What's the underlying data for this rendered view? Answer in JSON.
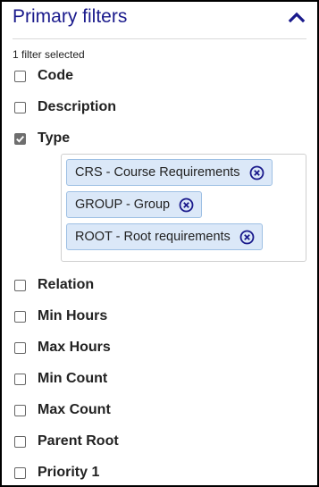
{
  "panel": {
    "title": "Primary filters",
    "selected_count": "1 filter selected"
  },
  "filters": [
    {
      "label": "Code",
      "checked": false
    },
    {
      "label": "Description",
      "checked": false
    },
    {
      "label": "Type",
      "checked": true
    },
    {
      "label": "Relation",
      "checked": false
    },
    {
      "label": "Min Hours",
      "checked": false
    },
    {
      "label": "Max Hours",
      "checked": false
    },
    {
      "label": "Min Count",
      "checked": false
    },
    {
      "label": "Max Count",
      "checked": false
    },
    {
      "label": "Parent Root",
      "checked": false
    },
    {
      "label": "Priority 1",
      "checked": false
    }
  ],
  "type_selections": [
    {
      "label": "CRS - Course Requirements"
    },
    {
      "label": "GROUP - Group"
    },
    {
      "label": "ROOT - Root requirements"
    }
  ],
  "icons": {
    "collapse": "chevron-up-icon",
    "remove": "circle-x-icon",
    "check": "checkmark-icon"
  },
  "colors": {
    "title": "#1a1a8c",
    "chip_bg": "#dbe8f8",
    "chip_border": "#9ec0e4",
    "remove_icon": "#1a1a8c",
    "checkbox_checked": "#6e6e6e"
  }
}
